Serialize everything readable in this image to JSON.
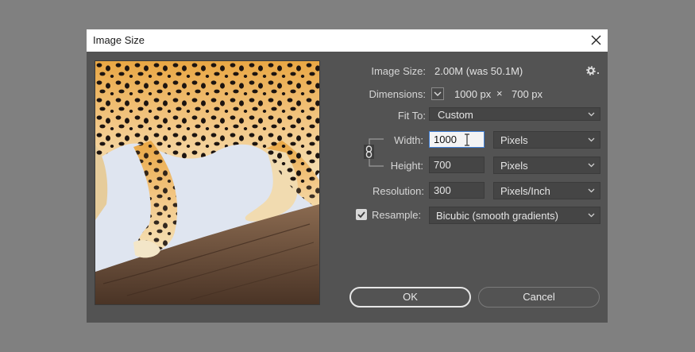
{
  "dialog": {
    "title": "Image Size"
  },
  "info": {
    "image_size_label": "Image Size:",
    "image_size_value": "2.00M (was 50.1M)",
    "dimensions_label": "Dimensions:",
    "dim_width": "1000 px",
    "dim_times": "×",
    "dim_height": "700 px"
  },
  "fit_to": {
    "label": "Fit To:",
    "value": "Custom"
  },
  "width": {
    "label": "Width:",
    "value": "1000",
    "unit": "Pixels"
  },
  "height": {
    "label": "Height:",
    "value": "700",
    "unit": "Pixels"
  },
  "resolution": {
    "label": "Resolution:",
    "value": "300",
    "unit": "Pixels/Inch"
  },
  "resample": {
    "label": "Resample:",
    "checked": true,
    "value": "Bicubic (smooth gradients)"
  },
  "buttons": {
    "ok": "OK",
    "cancel": "Cancel"
  },
  "icons": {
    "close": "close-icon",
    "gear": "gear-icon",
    "link": "link-icon",
    "chevron": "chevron-down-icon",
    "check": "check-icon"
  },
  "colors": {
    "dialog_bg": "#535353",
    "backdrop": "#808080",
    "field_bg": "#454545",
    "accent_focus": "#3f7fd6"
  }
}
